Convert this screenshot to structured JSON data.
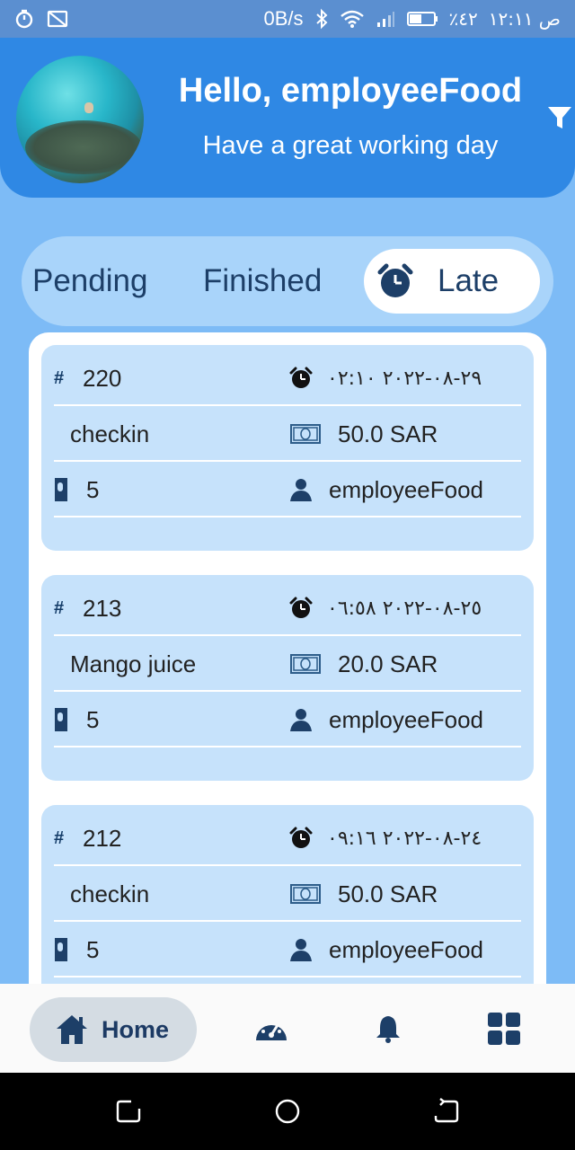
{
  "status_bar": {
    "net_speed": "0B/s",
    "battery": "٪٤٢",
    "time": "ص ١٢:١١"
  },
  "header": {
    "greeting": "Hello, employeeFood",
    "subtitle": "Have a great working day"
  },
  "tabs": [
    {
      "label": "Pending"
    },
    {
      "label": "Finished"
    },
    {
      "label": "Late"
    }
  ],
  "orders": [
    {
      "id": "220",
      "datetime": "٢٩-٠٨-٢٠٢٢ ٠٢:١٠",
      "item": "checkin",
      "price": "50.0 SAR",
      "qty": "5",
      "employee": "employeeFood"
    },
    {
      "id": "213",
      "datetime": "٢٥-٠٨-٢٠٢٢ ٠٦:٥٨",
      "item": "Mango juice",
      "price": "20.0 SAR",
      "qty": "5",
      "employee": "employeeFood"
    },
    {
      "id": "212",
      "datetime": "٢٤-٠٨-٢٠٢٢ ٠٩:١٦",
      "item": "checkin",
      "price": "50.0 SAR",
      "qty": "5",
      "employee": "employeeFood"
    }
  ],
  "order_labels": {
    "hash": "#"
  },
  "bottom_nav": {
    "home_label": "Home",
    "items": [
      "home-icon",
      "dashboard-gauge-icon",
      "bell-icon",
      "grid-menu-icon"
    ]
  },
  "colors": {
    "header_blue": "#2f88e4",
    "background_blue": "#7dbbf6",
    "card_blue": "#c6e2fb",
    "dark_navy": "#1d3f68"
  }
}
